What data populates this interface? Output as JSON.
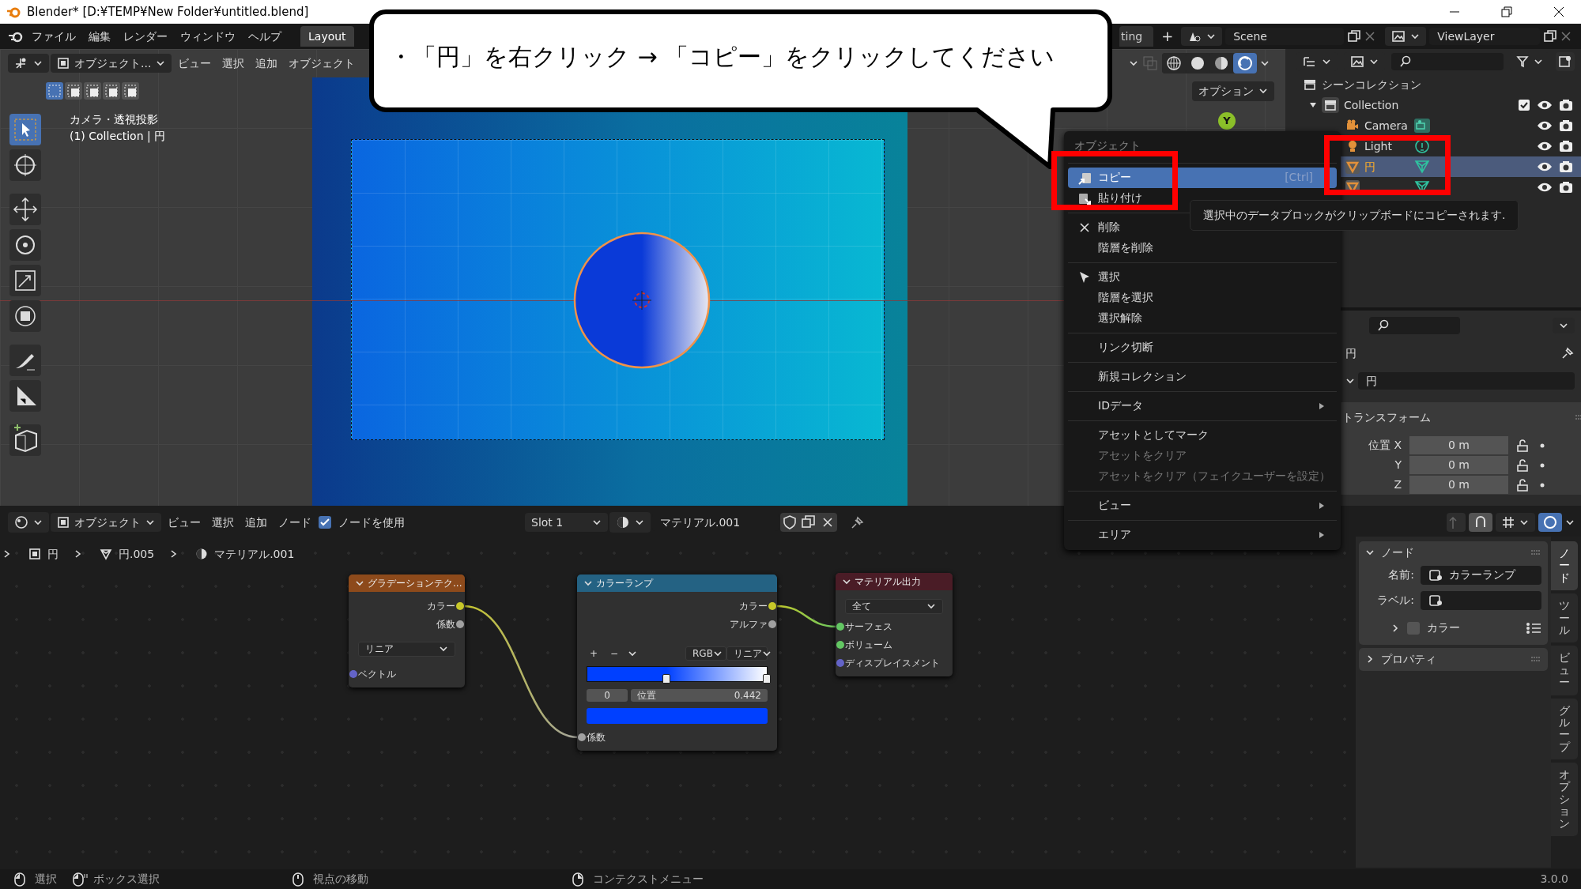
{
  "window": {
    "title": "Blender* [D:¥TEMP¥New Folder¥untitled.blend]"
  },
  "top_bar": {
    "menus": [
      "ファイル",
      "編集",
      "レンダー",
      "ウィンドウ",
      "ヘルプ"
    ],
    "workspace_tabs": [
      {
        "label": "Layout",
        "selected": true
      },
      {
        "label": "ting",
        "selected": false
      }
    ],
    "add_tab": "+",
    "scene": "Scene",
    "view_layer": "ViewLayer"
  },
  "callout": {
    "text": "・「円」を右クリック → 「コピー」をクリックしてください"
  },
  "viewport": {
    "mode": "オブジェクト...",
    "menus": [
      "ビュー",
      "選択",
      "追加",
      "オブジェクト"
    ],
    "select_modes": [
      {
        "selected": true
      },
      {
        "selected": false
      },
      {
        "selected": false
      },
      {
        "selected": false
      },
      {
        "selected": false
      }
    ],
    "shading": [
      {
        "kind": "wireframe",
        "selected": false
      },
      {
        "kind": "solid",
        "selected": false
      },
      {
        "kind": "material",
        "selected": false
      },
      {
        "kind": "rendered",
        "selected": true
      }
    ],
    "options": "オプション",
    "gizmo_axis": "Y",
    "view_name": "カメラ・透視投影",
    "collection_info": "(1) Collection | 円",
    "tools": [
      {
        "kind": "select",
        "selected": true
      },
      {
        "kind": "cursor",
        "selected": false
      },
      {
        "kind": "move",
        "selected": false
      },
      {
        "kind": "rotate",
        "selected": false
      },
      {
        "kind": "scale",
        "selected": false
      },
      {
        "kind": "transform",
        "selected": false
      },
      {
        "kind": "annotate",
        "selected": false
      },
      {
        "kind": "measure",
        "selected": false
      },
      {
        "kind": "add-cube",
        "selected": false
      }
    ]
  },
  "outliner": {
    "root": "シーンコレクション",
    "items": [
      {
        "name": "Collection",
        "kind": "collection",
        "expanded": true,
        "checked": true,
        "selected": false,
        "children": [
          {
            "name": "Camera",
            "kind": "camera",
            "selected": false
          },
          {
            "name": "Light",
            "kind": "light",
            "selected": false
          },
          {
            "name": "円",
            "kind": "mesh",
            "selected": true
          },
          {
            "kind": "mesh",
            "selected": false
          }
        ]
      }
    ]
  },
  "context_menu": {
    "title": "オブジェクト",
    "sections": [
      {
        "items": [
          {
            "label": "コピー",
            "kind": "copy",
            "shortcut": "[Ctrl]",
            "selected": true,
            "disabled": false
          },
          {
            "label": "貼り付け",
            "kind": "paste",
            "selected": false,
            "disabled": false
          }
        ]
      },
      {
        "items": [
          {
            "label": "削除",
            "kind": "delete",
            "selected": false,
            "disabled": false
          },
          {
            "label": "階層を削除",
            "selected": false,
            "disabled": false
          }
        ]
      },
      {
        "items": [
          {
            "label": "選択",
            "kind": "select",
            "selected": false,
            "disabled": false
          },
          {
            "label": "階層を選択",
            "selected": false,
            "disabled": false
          },
          {
            "label": "選択解除",
            "selected": false,
            "disabled": false
          }
        ]
      },
      {
        "items": [
          {
            "label": "リンク切断",
            "selected": false,
            "disabled": false
          }
        ]
      },
      {
        "items": [
          {
            "label": "新規コレクション",
            "selected": false,
            "disabled": false
          }
        ]
      },
      {
        "items": [
          {
            "label": "IDデータ",
            "kind": "submenu",
            "selected": false,
            "disabled": false
          }
        ]
      },
      {
        "items": [
          {
            "label": "アセットとしてマーク",
            "selected": false,
            "disabled": false
          },
          {
            "label": "アセットをクリア",
            "selected": false,
            "disabled": true
          },
          {
            "label": "アセットをクリア（フェイクユーザーを設定）",
            "selected": false,
            "disabled": true
          }
        ]
      },
      {
        "items": [
          {
            "label": "ビュー",
            "kind": "submenu",
            "selected": false,
            "disabled": false
          }
        ]
      },
      {
        "items": [
          {
            "label": "エリア",
            "kind": "submenu",
            "selected": false,
            "disabled": false
          }
        ]
      }
    ]
  },
  "tooltip": {
    "text": "選択中のデータブロックがクリップボードにコピーされます."
  },
  "properties": {
    "object_name": "円",
    "data_name": "円",
    "panel": "トランスフォーム",
    "fields": [
      {
        "label": "位置 X",
        "value": "0 m"
      },
      {
        "label": "Y",
        "value": "0 m"
      },
      {
        "label": "Z",
        "value": "0 m"
      }
    ]
  },
  "node_editor": {
    "mode": "オブジェクト",
    "menus": [
      "ビュー",
      "選択",
      "追加",
      "ノード"
    ],
    "use_nodes": {
      "label": "ノードを使用",
      "checked": true
    },
    "slot": "Slot 1",
    "material": "マテリアル.001",
    "breadcrumbs": [
      {
        "kind": "object",
        "label": "円"
      },
      {
        "kind": "mesh",
        "label": "円.005"
      },
      {
        "kind": "material",
        "label": "マテリアル.001"
      }
    ],
    "nodes": [
      {
        "kind": "texture",
        "title": "グラデーションテク...",
        "color": "#8d4a1b",
        "outputs": [
          {
            "label": "カラー",
            "color": "#c7c729"
          },
          {
            "label": "係数",
            "color": "#a1a1a1"
          }
        ],
        "dropdown": "リニア",
        "inputs": [
          {
            "label": "ベクトル",
            "color": "#6363c7"
          }
        ]
      },
      {
        "kind": "color_ramp",
        "title": "カラーランプ",
        "color": "#246283",
        "outputs": [
          {
            "label": "カラー",
            "color": "#c7c729"
          },
          {
            "label": "アルファ",
            "color": "#a1a1a1"
          }
        ],
        "ramp_buttons": [
          "+",
          "−"
        ],
        "color_mode": "RGB",
        "interpolation": "リニア",
        "stop_index": "0",
        "position_label": "位置",
        "position_value": "0.442",
        "level": 0.442,
        "inputs": [
          {
            "label": "係数",
            "color": "#a1a1a1"
          }
        ]
      },
      {
        "kind": "output",
        "title": "マテリアル出力",
        "color": "#4a1c26",
        "dropdown": "全て",
        "inputs": [
          {
            "label": "サーフェス",
            "color": "#63c763"
          },
          {
            "label": "ボリューム",
            "color": "#63c763"
          },
          {
            "label": "ディスプレイスメント",
            "color": "#6363c7"
          }
        ]
      }
    ],
    "sidebar": {
      "panels": [
        {
          "title": "ノード",
          "expanded": true,
          "fields": [
            {
              "label": "名前:",
              "value": "カラーランプ"
            },
            {
              "label": "ラベル:"
            }
          ],
          "subpanel": {
            "label": "カラー",
            "expanded": false,
            "checked": false
          }
        },
        {
          "title": "プロパティ",
          "expanded": false
        }
      ],
      "tabs": [
        {
          "label": "ノード",
          "selected": true
        },
        {
          "label": "ツール",
          "selected": false
        },
        {
          "label": "ビュー",
          "selected": false
        },
        {
          "label": "グループ",
          "selected": false
        },
        {
          "label": "オプション",
          "selected": false
        }
      ]
    }
  },
  "status_bar": {
    "hints": [
      {
        "kind": "mouse-left",
        "label": "選択"
      },
      {
        "kind": "mouse-drag",
        "label": "ボックス選択"
      },
      {
        "kind": "mouse-middle",
        "label": "視点の移動"
      },
      {
        "kind": "mouse-right",
        "label": "コンテクストメニュー"
      }
    ],
    "version": "3.0.0"
  }
}
